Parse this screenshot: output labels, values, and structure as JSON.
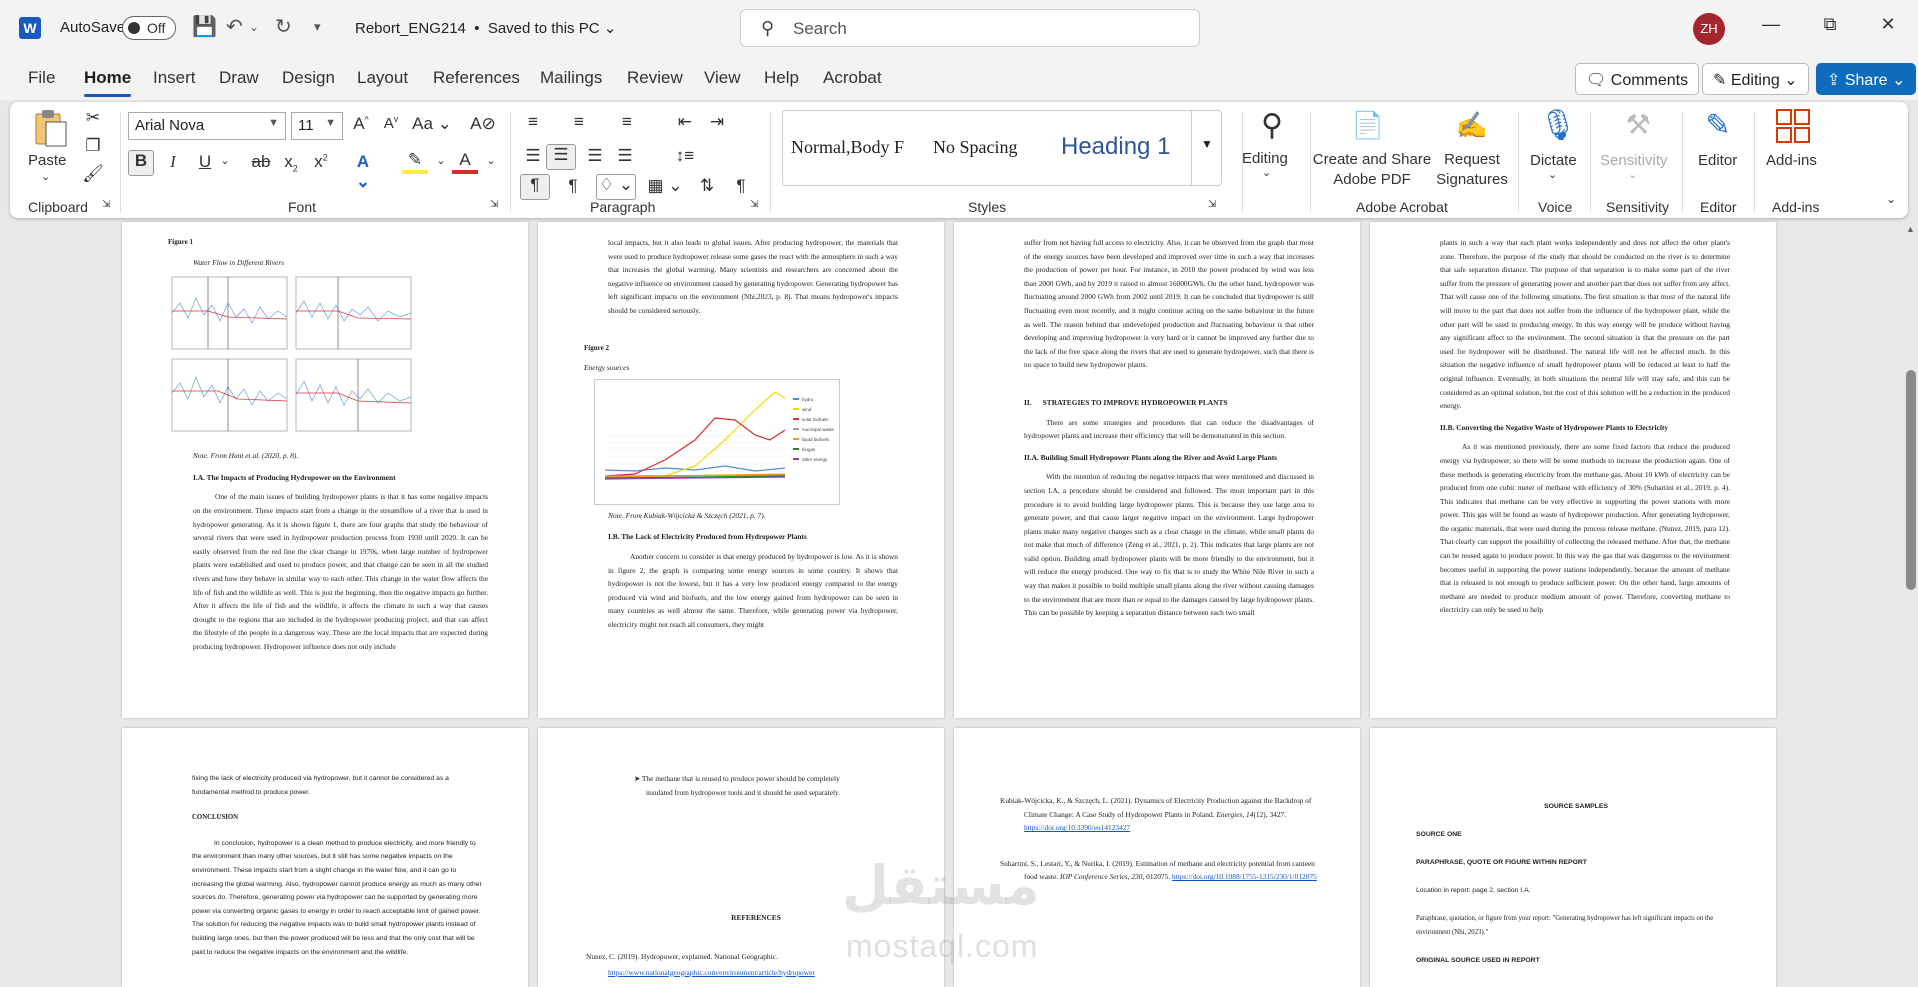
{
  "app": {
    "autosave": "AutoSave",
    "toggle": "Off",
    "doc_title": "Rebort_ENG214",
    "saved": "Saved to this PC",
    "search_placeholder": "Search",
    "initials": "ZH"
  },
  "menu": [
    "File",
    "Home",
    "Insert",
    "Draw",
    "Design",
    "Layout",
    "References",
    "Mailings",
    "Review",
    "View",
    "Help",
    "Acrobat"
  ],
  "buttons": {
    "comments": "Comments",
    "editing": "Editing",
    "share": "Share"
  },
  "ribbon": {
    "paste": "Paste",
    "font_name": "Arial Nova",
    "font_size": "11",
    "styles": [
      "Normal,Body F",
      "No Spacing",
      "Heading 1"
    ],
    "editing": "Editing",
    "create_pdf": [
      "Create and Share",
      "Adobe PDF"
    ],
    "request_sig": [
      "Request",
      "Signatures"
    ],
    "dictate": "Dictate",
    "sensitivity": "Sensitivity",
    "editor": "Editor",
    "addins": "Add-ins"
  },
  "groups": [
    "Clipboard",
    "Font",
    "Paragraph",
    "Styles",
    "Adobe Acrobat",
    "Voice",
    "Sensitivity",
    "Editor",
    "Add-ins"
  ],
  "chart_data": {
    "type": "line",
    "series": [
      {
        "name": "hydro"
      },
      {
        "name": "wind"
      },
      {
        "name": "solar biofuels"
      },
      {
        "name": "municipal waste"
      },
      {
        "name": "liquid biofuels"
      },
      {
        "name": "biogas"
      },
      {
        "name": "other energy"
      }
    ]
  },
  "pages": {
    "p1": {
      "fig": "Figure 1",
      "caption": "Water Flow in Different Rivers",
      "note": "Note. From Hunt et al. (2020, p. 8).",
      "h": "I.A. The Impacts of Producing Hydropower on the Environment",
      "body": "One of the main issues of building hydropower plants is that it has some negative impacts on the environment. These impacts start from a change in the streamflow of a river that is used in hydropower generating. As it is shown figure 1, there are four graphs that study the behaviour of several rivers that were used in hydropower production process from 1930 until 2020. It can be easily observed from the red line the clear change in 1970s, when large number of hydropower plants were established and used to produce power, and that change can be seen in all the studied rivers and how they behave in similar way to each other. This change in the water flow affects the life of fish and the wildlife as well. This is just the beginning, then the negative impacts go further. After it affects the life of fish and the wildlife, it affects the climate in such a way that causes drought to the regions that are included in the hydropower producing project, and that can affect the lifestyle of the people in a dangerous way. These are the local impacts that are expected during producing hydropower. Hydropower influence does not only include"
    },
    "p2": {
      "top": "local impacts, but it also leads to global issues. After producing hydropower, the materials that were used to produce hydropower release some gases the react with the atmosphere in such a way that increases the global warming. Many scientists and researchers are concerned about the negative influence on environment caused by generating hydropower. Generating hydropower has left significant impacts on the environment (Nhi,2023, p. 8). That means hydropower's impacts should be considered seriously.",
      "fig": "Figure 2",
      "caption": "Energy sources",
      "note": "Note. From Kubiak-Wójcicka & Szczęch (2021, p. 7).",
      "h": "I.B. The Lack of Electricity Produced from Hydropower Plants",
      "body": "Another concern to consider is that energy produced by hydropower is low. As it is shown in figure 2, the graph is comparing some energy sources in some country. It shows that hydropower is not the lowest, but it has a very low produced energy compared to the energy produced via wind and biofuels, and the low energy gained from hydropower can be seen in many countries as well almost the same. Therefore, while generating power via hydropower, electricity might not reach all consumers, they might"
    },
    "p3": {
      "top": "suffer from not having full access to electricity. Also, it can be observed from the graph that most of the energy sources have been developed and improved over time in such a way that increases the production of power per hour. For instance, in 2010 the power produced by wind was less than 2000 GWh, and by 2019 it raised to almost 16000GWh. On the other hand, hydropower was fluctuating around 2000 GWh from 2002 until 2019. It can be concluded that hydropower is still fluctuating even most recently, and it might continue acting on the same behaviour in the future as well. The reason behind that undeveloped production and fluctuating behaviour is that other developing and improving hydropower is very hard or it cannot be improved any further due to the lack of the free space along the rivers that are used to generate hydropower, such that there is no space to build new hydropower plants.",
      "h1": "II.      STRATEGIES TO IMPROVE HYDROPOWER PLANTS",
      "intro": "There are some strategies and procedures that can reduce the disadvantages of hydropower plants and increase their efficiency that will be demonstrated in this section.",
      "h2": "II.A. Building Small Hydropower Plants along the River and Avoid Large Plants",
      "body": "With the intention of reducing the negative impacts that were mentioned and discussed in section I.A, a procedure should be considered and followed. The most important part in this procedure is to avoid building large hydropower plants. This is because they use large area to generate power, and that cause larger negative impact on the environment. Large hydropower plants make many negative changes such as a clear change in the climate, while small plants do not make that much of difference (Zeng et al., 2021, p. 2). This indicates that large plants are not valid option. Building small hydropower plants will be more friendly to the environment, but it will reduce the energy produced. One way to fix that is to study the White Nile River in such a way that makes it possible to build multiple small plants along the river without causing damages to the environment that are more than or equal to the damages caused by large hydropower plants. This can be possible by keeping a separation distance between each two small"
    },
    "p4": {
      "top": "plants in such a way that each plant works independently and does not affect the other plant's zone. Therefore, the purpose of the study that should be conducted on the river is to determine that safe separation distance. The purpose of that separation is to make some part of the river suffer from the pressure of generating power and another part that does not suffer from any affect. That will cause one of the following situations. The first situation is that most of the natural life will move to the part that does not suffer from the influence of the hydropower plant, while the other part will be used in producing energy. In this way energy will be produce without having any significant affect to the environment. The second situation is that the pressure on the part used for hydropower will be distributed. The natural life will not be affected much. In this situation the negative influence of small hydropower plants will be reduced at least to half the original influence. Eventually, in both situations the neutral life will stay safe, and this can be considered as an optimal solution, but the cost of this solution will be a reduction in the produced energy.",
      "h": "II.B. Converting the Negative Waste of Hydropower Plants to Electricity",
      "body": "As it was mentioned previously, there are some fixed factors that reduce the produced energy via hydropower, so there will be some methods to increase the production again. One of these methods is generating electricity from the methane gas. About 10 kWh of electricity can be produced from one cubic meter of methane with efficiency of 30% (Suhartini et al., 2019, p. 4). This indicates that methane can be very effective in supporting the power stations with more power. This gas will be found as waste of hydropower production. After generating hydropower, the organic materials, that were used during the process release methane. (Nunez, 2019, para 12). That clearly can support the possibility of collecting the released methane. After that, the methane can be reused again to produce power. In this way the gas that was dangerous to the environment becomes useful in supporting the power stations independently, because the amount of methane that is released is not enough to produce sufficient power. On the other hand, large amounts of methane are needed to produce medium amount of power. Therefore, converting methane to electricity can only be used to help"
    },
    "p5": {
      "top": "fixing the lack of electricity produced via hydropower, but it cannot be considered as a fundamental method to produce power.",
      "h": "CONCLUSION",
      "body": "In conclusion, hydropower is a clean method to produce electricity, and more friendly to the environment than many other sources, but it still has some negative impacts on the environment. These impacts start from a slight change in the water flow, and it can go to increasing the global warming. Also, hydropower cannot produce energy as much as many other sources do. Therefore, generating power via hydropower can be supported by generating more power via converting organic gases to energy in order to reach acceptable limit of gained power. The solution for reducing the negative impacts was to build small hydropower plants instead of building large ones, but then the power produced will be less and that the only cost that will be paid to reduce the negative impacts on the environment and the wildlife."
    },
    "p6": {
      "bullet": "The methane that is reused to produce power should be completely insulated from hydropower tools and it should be used separately.",
      "h": "REFERENCES",
      "ref": "Nunez, C. (2019). Hydropower, explained. National Geographic.",
      "link": "https://www.nationalgeographic.com/environment/article/hydropower"
    },
    "p7": {
      "r1a": "Kubiak-Wójcicka, K., & Szczęch, L. (2021). Dynamics of Electricity Production against the Backdrop of Climate Change: A Case Study of Hydropower Plants in Poland.",
      "r1b": "Energies, 14",
      "r1c": "(12), 3427.",
      "r1link": "https://doi.org/10.3390/en14123427",
      "r2a": "Suhartini, S., Lestari, Y., & Nurika, I. (2019). Estimation of methane and electricity potential from canteen food waste.",
      "r2b": "IOP Conference Series, 230",
      "r2c": ", 012075.",
      "r2link": "https://doi.org/10.1088/1755-1315/230/1/012075"
    },
    "p8": {
      "title": "SOURCE SAMPLES",
      "s1": "SOURCE ONE",
      "s2": "PARAPHRASE, QUOTE OR FIGURE WITHIN REPORT",
      "s3": "Location in report: page 2, section I.A.",
      "s4": "Paraphrase, quotation, or figure from your report: \"Generating hydropower has left significant impacts on the environment (Nhi, 2023).\"",
      "s5": "ORIGINAL SOURCE USED IN REPORT"
    }
  },
  "watermark": {
    "arabic": "مستقل",
    "latin": "mostaql.com"
  }
}
